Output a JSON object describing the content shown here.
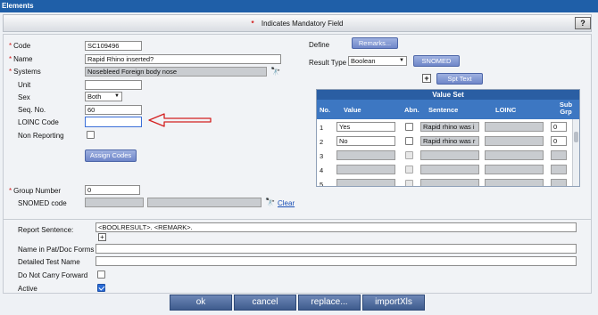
{
  "window": {
    "title": "Elements"
  },
  "mandatory": {
    "text": "Indicates Mandatory Field",
    "star": "*",
    "help": "?"
  },
  "form": {
    "code": {
      "label": "Code",
      "value": "SC109496"
    },
    "name": {
      "label": "Name",
      "value": "Rapid Rhino inserted?"
    },
    "systems": {
      "label": "Systems",
      "value": "Nosebleed Foreign body nose"
    },
    "unit": {
      "label": "Unit",
      "value": ""
    },
    "sex": {
      "label": "Sex",
      "value": "Both"
    },
    "seq_no": {
      "label": "Seq. No.",
      "value": "60"
    },
    "loinc_code": {
      "label": "LOINC Code",
      "value": ""
    },
    "non_reporting": {
      "label": "Non Reporting",
      "checked": false
    },
    "assign_codes": "Assign Codes",
    "group_number": {
      "label": "Group Number",
      "value": "0"
    },
    "snomed_code": {
      "label": "SNOMED code",
      "clear": "Clear"
    }
  },
  "right": {
    "define_label": "Define",
    "remarks_btn": "Remarks...",
    "result_type_label": "Result Type",
    "result_type_value": "Boolean",
    "snomed_btn": "SNOMED",
    "plus": "+",
    "spt_text_btn": "Spt Text",
    "value_set": {
      "title": "Value Set",
      "headers": {
        "no": "No.",
        "value": "Value",
        "abn": "Abn.",
        "sentence": "Sentence",
        "loinc": "LOINC",
        "subgrp": "Sub Grp"
      },
      "rows": [
        {
          "no": "1",
          "value": "Yes",
          "sentence": "Rapid rhino was i",
          "subgrp": "0"
        },
        {
          "no": "2",
          "value": "No",
          "sentence": "Rapid rhino was r",
          "subgrp": "0"
        },
        {
          "no": "3",
          "value": "",
          "sentence": "",
          "subgrp": ""
        },
        {
          "no": "4",
          "value": "",
          "sentence": "",
          "subgrp": ""
        },
        {
          "no": "5",
          "value": "",
          "sentence": "",
          "subgrp": ""
        }
      ]
    }
  },
  "lower": {
    "report_sentence": {
      "label": "Report Sentence:",
      "value": "<BOOLRESULT>. <REMARK>."
    },
    "name_in_forms": {
      "label": "Name in Pat/Doc Forms",
      "value": ""
    },
    "detailed_test_name": {
      "label": "Detailed Test Name",
      "value": ""
    },
    "do_not_carry_forward": {
      "label": "Do Not Carry Forward",
      "checked": false
    },
    "active": {
      "label": "Active",
      "checked": true
    }
  },
  "footer": {
    "ok": "ok",
    "cancel": "cancel",
    "replace": "replace...",
    "import": "importXls"
  },
  "colors": {
    "title_bar": "#1f5fa8",
    "mandatory_star": "#d21b1b",
    "arrow": "#d42020",
    "footer_button": "#4a669a"
  }
}
